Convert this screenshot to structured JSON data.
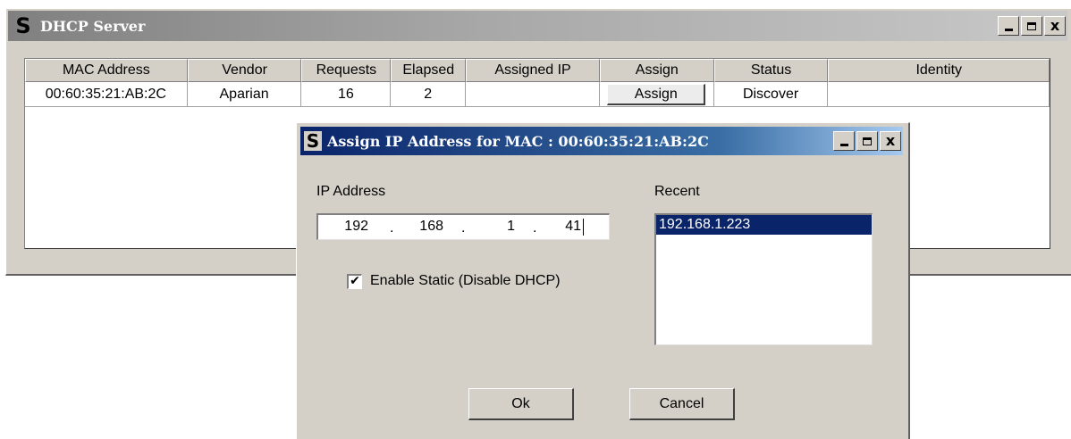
{
  "main_window": {
    "title": "DHCP Server",
    "icon_letter": "S",
    "controls": {
      "minimize": "_",
      "maximize": "□",
      "close": "x"
    }
  },
  "grid": {
    "columns": [
      "MAC Address",
      "Vendor",
      "Requests",
      "Elapsed",
      "Assigned IP",
      "Assign",
      "Status",
      "Identity"
    ],
    "rows": [
      {
        "mac": "00:60:35:21:AB:2C",
        "vendor": "Aparian",
        "requests": "16",
        "elapsed": "2",
        "assigned_ip": "",
        "assign_label": "Assign",
        "status": "Discover",
        "identity": ""
      }
    ]
  },
  "dialog": {
    "title": "Assign IP Address for MAC : 00:60:35:21:AB:2C",
    "icon_letter": "S",
    "ip_label": "IP Address",
    "ip_octets": [
      "192",
      "168",
      "1",
      "41"
    ],
    "static_checkbox_label": "Enable Static (Disable DHCP)",
    "static_checked": true,
    "check_mark": "✔",
    "recent_label": "Recent",
    "recent_items": [
      "192.168.1.223"
    ],
    "ok_label": "Ok",
    "cancel_label": "Cancel"
  },
  "colors": {
    "window_face": "#d4d0c8",
    "active_title": "#0a246a",
    "selection": "#0a246a"
  }
}
